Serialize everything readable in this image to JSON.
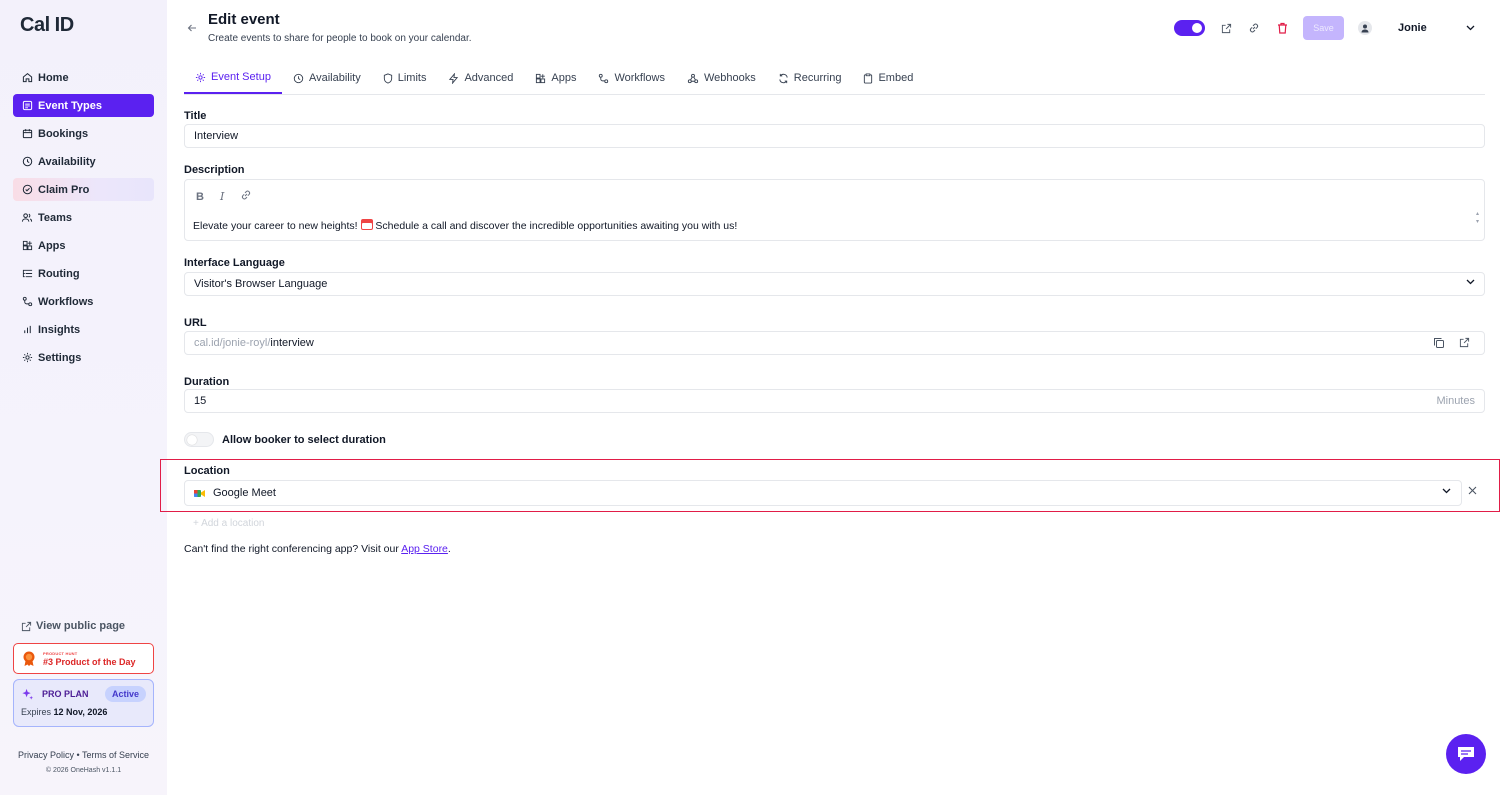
{
  "brand": {
    "logo": "Cal ID",
    "accent": "#5b21f0",
    "danger": "#e11d48"
  },
  "sidebar": {
    "items": [
      {
        "label": "Home",
        "icon": "home-icon"
      },
      {
        "label": "Event Types",
        "icon": "event-types-icon",
        "active": true
      },
      {
        "label": "Bookings",
        "icon": "calendar-icon"
      },
      {
        "label": "Availability",
        "icon": "clock-icon"
      },
      {
        "label": "Claim Pro",
        "icon": "badge-icon"
      },
      {
        "label": "Teams",
        "icon": "users-icon"
      },
      {
        "label": "Apps",
        "icon": "grid-plus-icon"
      },
      {
        "label": "Routing",
        "icon": "list-tree-icon"
      },
      {
        "label": "Workflows",
        "icon": "workflow-icon"
      },
      {
        "label": "Insights",
        "icon": "bar-chart-icon"
      },
      {
        "label": "Settings",
        "icon": "gear-icon"
      }
    ],
    "view_public": "View public page",
    "product_hunt": {
      "small": "PRODUCT HUNT",
      "big": "#3 Product of the Day"
    },
    "pro_plan": {
      "title": "PRO PLAN",
      "status": "Active",
      "expires_label": "Expires",
      "expires_date": "12 Nov, 2026"
    },
    "footer": {
      "links": "Privacy Policy • Terms of Service",
      "copyright": "© 2026 OneHash v1.1.1"
    }
  },
  "header": {
    "title": "Edit event",
    "subtitle": "Create events to share for people to book on your calendar.",
    "save_label": "Save",
    "user_name": "Jonie"
  },
  "tabs": [
    {
      "label": "Event Setup",
      "active": true
    },
    {
      "label": "Availability"
    },
    {
      "label": "Limits"
    },
    {
      "label": "Advanced"
    },
    {
      "label": "Apps"
    },
    {
      "label": "Workflows"
    },
    {
      "label": "Webhooks"
    },
    {
      "label": "Recurring"
    },
    {
      "label": "Embed"
    }
  ],
  "form": {
    "title_label": "Title",
    "title_value": "Interview",
    "description_label": "Description",
    "description_before": "Elevate your career to new heights! ",
    "description_after": " Schedule a call and discover the incredible opportunities awaiting you with us!",
    "language_label": "Interface Language",
    "language_value": "Visitor's Browser Language",
    "url_label": "URL",
    "url_prefix": "cal.id/jonie-royl/",
    "url_slug": "interview",
    "duration_label": "Duration",
    "duration_value": "15",
    "duration_unit": "Minutes",
    "allow_duration_label": "Allow booker to select duration",
    "location_label": "Location",
    "location_value": "Google Meet",
    "add_location": "+ Add a location",
    "cant_find_text": "Can't find the right conferencing app? Visit our ",
    "app_store_link": "App Store",
    "cant_find_end": "."
  }
}
